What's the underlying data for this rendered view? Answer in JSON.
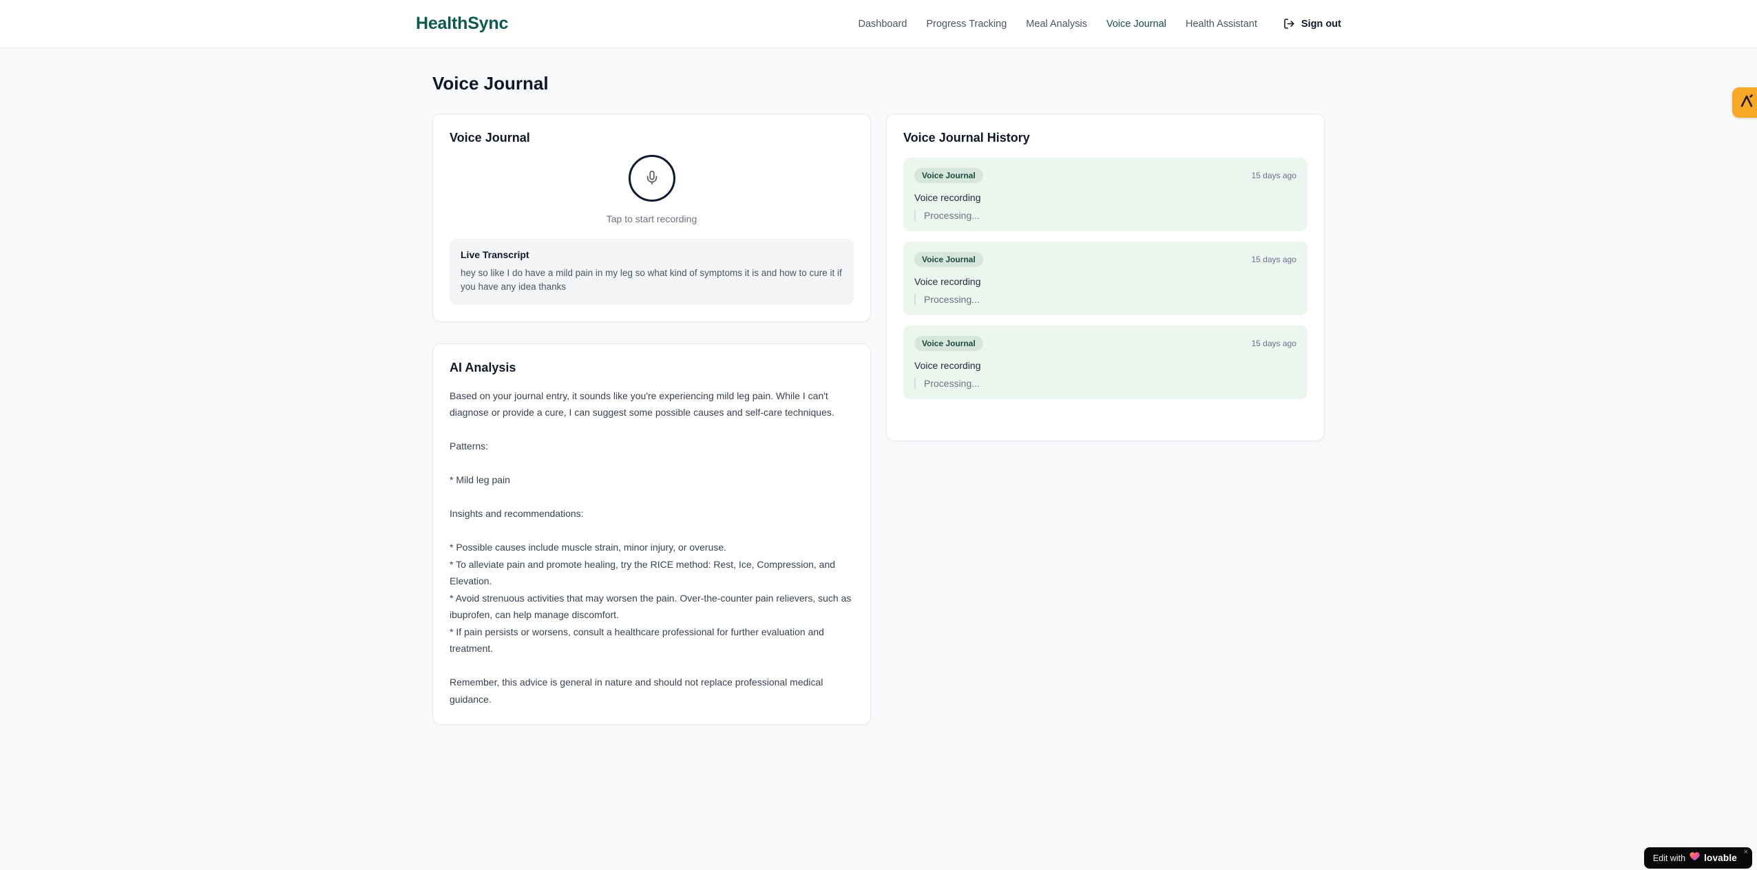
{
  "brand": {
    "name": "HealthSync",
    "color": "#0c5a4e"
  },
  "nav": {
    "items": [
      {
        "label": "Dashboard",
        "active": false
      },
      {
        "label": "Progress Tracking",
        "active": false
      },
      {
        "label": "Meal Analysis",
        "active": false
      },
      {
        "label": "Voice Journal",
        "active": true
      },
      {
        "label": "Health Assistant",
        "active": false
      }
    ],
    "signout_label": "Sign out"
  },
  "page": {
    "title": "Voice Journal"
  },
  "recorder_card": {
    "title": "Voice Journal",
    "tap_hint": "Tap to start recording",
    "transcript_title": "Live Transcript",
    "transcript_text": "hey so like I do have a mild pain in my leg so what kind of symptoms it is and how to cure it if you have any idea thanks"
  },
  "analysis_card": {
    "title": "AI Analysis",
    "body": "Based on your journal entry, it sounds like you're experiencing mild leg pain. While I can't diagnose or provide a cure, I can suggest some possible causes and self-care techniques.\n\nPatterns:\n\n* Mild leg pain\n\nInsights and recommendations:\n\n* Possible causes include muscle strain, minor injury, or overuse.\n* To alleviate pain and promote healing, try the RICE method: Rest, Ice, Compression, and Elevation.\n* Avoid strenuous activities that may worsen the pain. Over-the-counter pain relievers, such as ibuprofen, can help manage discomfort.\n* If pain persists or worsens, consult a healthcare professional for further evaluation and treatment.\n\nRemember, this advice is general in nature and should not replace professional medical guidance."
  },
  "history_card": {
    "title": "Voice Journal History",
    "entries": [
      {
        "badge": "Voice Journal",
        "time": "15 days ago",
        "title": "Voice recording",
        "status": "Processing..."
      },
      {
        "badge": "Voice Journal",
        "time": "15 days ago",
        "title": "Voice recording",
        "status": "Processing..."
      },
      {
        "badge": "Voice Journal",
        "time": "15 days ago",
        "title": "Voice recording",
        "status": "Processing..."
      }
    ]
  },
  "colors": {
    "accent_teal": "#134e4a",
    "entry_background": "#edf5ef",
    "badge_background": "#d7e6dc",
    "side_badge_amber": "#f9a825"
  },
  "edit_badge": {
    "prefix": "Edit with",
    "brand": "lovable",
    "close": "×"
  }
}
